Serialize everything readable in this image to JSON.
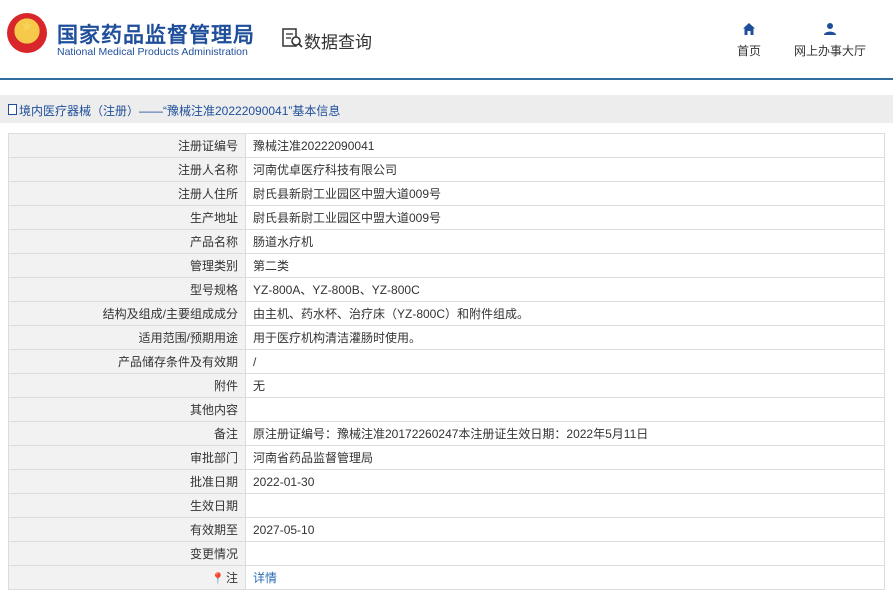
{
  "header": {
    "org_name_cn": "国家药品监督管理局",
    "org_name_en": "National Medical Products Administration",
    "page_title": "数据查询",
    "nav": [
      {
        "label": "首页",
        "icon": "home-icon"
      },
      {
        "label": "网上办事大厅",
        "icon": "user-icon"
      }
    ]
  },
  "breadcrumb": {
    "text": "境内医疗器械（注册）——“豫械注准20222090041”基本信息"
  },
  "detail": {
    "rows": [
      {
        "label": "注册证编号",
        "value": "豫械注准20222090041"
      },
      {
        "label": "注册人名称",
        "value": "河南优卓医疗科技有限公司"
      },
      {
        "label": "注册人住所",
        "value": "尉氏县新尉工业园区中盟大道009号"
      },
      {
        "label": "生产地址",
        "value": "尉氏县新尉工业园区中盟大道009号"
      },
      {
        "label": "产品名称",
        "value": "肠道水疗机"
      },
      {
        "label": "管理类别",
        "value": "第二类"
      },
      {
        "label": "型号规格",
        "value": "YZ-800A、YZ-800B、YZ-800C"
      },
      {
        "label": "结构及组成/主要组成成分",
        "value": "由主机、药水杯、治疗床（YZ-800C）和附件组成。"
      },
      {
        "label": "适用范围/预期用途",
        "value": "用于医疗机构清洁灌肠时使用。"
      },
      {
        "label": "产品储存条件及有效期",
        "value": "/"
      },
      {
        "label": "附件",
        "value": "无"
      },
      {
        "label": "其他内容",
        "value": ""
      },
      {
        "label": "备注",
        "value": "原注册证编号：豫械注准20172260247本注册证生效日期：2022年5月11日"
      },
      {
        "label": "审批部门",
        "value": "河南省药品监督管理局"
      },
      {
        "label": "批准日期",
        "value": "2022-01-30"
      },
      {
        "label": "生效日期",
        "value": ""
      },
      {
        "label": "有效期至",
        "value": "2027-05-10"
      },
      {
        "label": "变更情况",
        "value": ""
      }
    ],
    "note": {
      "label": "注",
      "icon": "pin-icon",
      "link_text": "详情"
    }
  },
  "colors": {
    "brand_blue": "#1f4f9a",
    "link_blue": "#2b6db3",
    "label_bg": "#f2f2f2",
    "border": "#dcdcdc"
  }
}
